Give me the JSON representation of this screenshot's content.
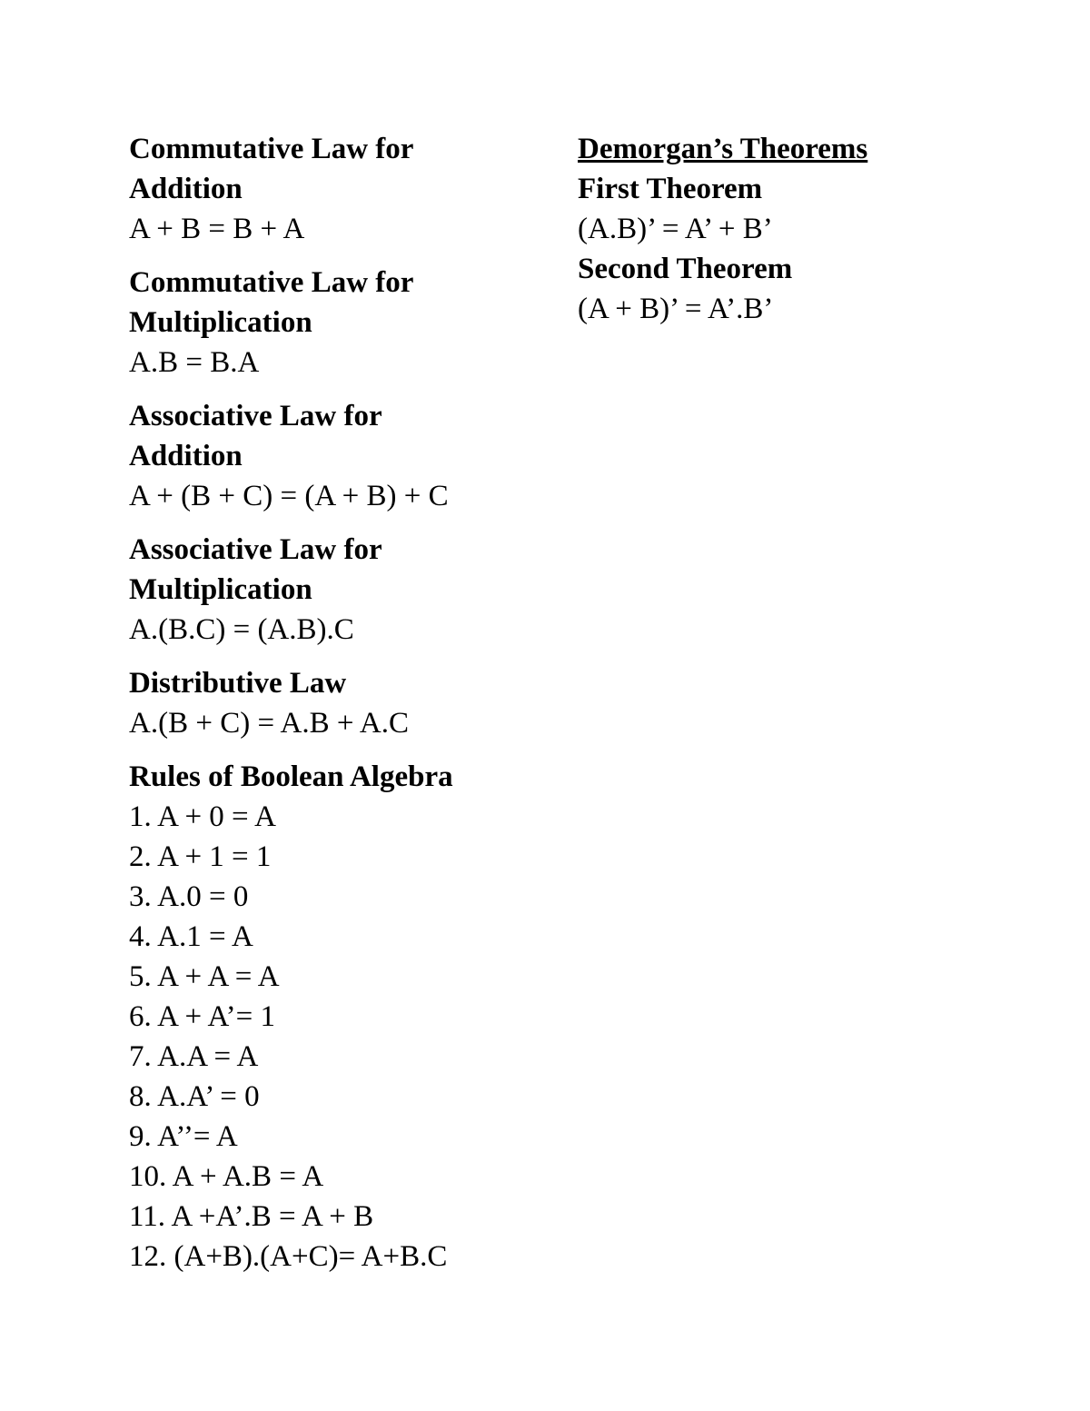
{
  "left_column": {
    "sections": [
      {
        "heading_line1": "Commutative Law for",
        "heading_line2": "Addition",
        "formula": "A + B = B + A"
      },
      {
        "heading_line1": "Commutative Law for",
        "heading_line2": "Multiplication",
        "formula": "A.B = B.A"
      },
      {
        "heading_line1": "Associative Law for",
        "heading_line2": "Addition",
        "formula": "A + (B + C) = (A + B) + C"
      },
      {
        "heading_line1": "Associative Law for",
        "heading_line2": "Multiplication",
        "formula": "A.(B.C) = (A.B).C"
      },
      {
        "heading_line1": "Distributive Law",
        "formula": "A.(B + C) = A.B + A.C"
      }
    ],
    "rules": {
      "heading": "Rules of Boolean Algebra",
      "items": [
        "1. A + 0 = A",
        "2. A + 1 = 1",
        "3. A.0 = 0",
        "4. A.1 = A",
        "5. A + A = A",
        "6. A + A’= 1",
        "7. A.A = A",
        "8. A.A’ = 0",
        "9. A’’= A",
        "10. A + A.B = A",
        "11. A +A’.B = A + B",
        "12. (A+B).(A+C)= A+B.C"
      ]
    }
  },
  "right_column": {
    "title": "Demorgan’s Theorems",
    "theorems": [
      {
        "heading": "First Theorem",
        "formula": "(A.B)’ = A’ + B’"
      },
      {
        "heading": "Second Theorem",
        "formula": "(A + B)’ = A’.B’"
      }
    ]
  }
}
